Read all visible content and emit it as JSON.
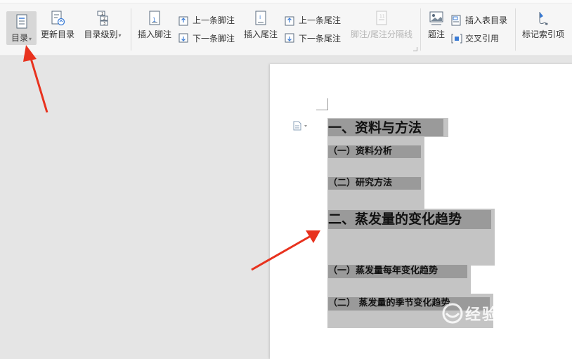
{
  "ribbon": {
    "toc": "目录",
    "update_toc": "更新目录",
    "toc_level": "目录级别",
    "insert_footnote": "插入脚注",
    "prev_footnote": "上一条脚注",
    "next_footnote": "下一条脚注",
    "insert_endnote": "插入尾注",
    "prev_endnote": "上一条尾注",
    "next_endnote": "下一条尾注",
    "separator": "脚注/尾注分隔线",
    "caption": "题注",
    "insert_table_of_figures": "插入表目录",
    "cross_reference": "交叉引用",
    "mark_index_entry": "标记索引项"
  },
  "document": {
    "headings": [
      "一、资料与方法",
      "（一）资料分析",
      "（二）研究方法",
      "二、蒸发量的变化趋势",
      "（一）蒸发量每年变化趋势",
      "（二）  蒸发量的季节变化趋势"
    ]
  },
  "watermark": {
    "text": "经验",
    "url": "jingyan.baidu.com"
  },
  "colors": {
    "annotation_arrow": "#e8321e",
    "selection": "#c4c4c4",
    "heading_highlight": "#9a9a9a",
    "ribbon_bg": "#f6f6f6"
  }
}
